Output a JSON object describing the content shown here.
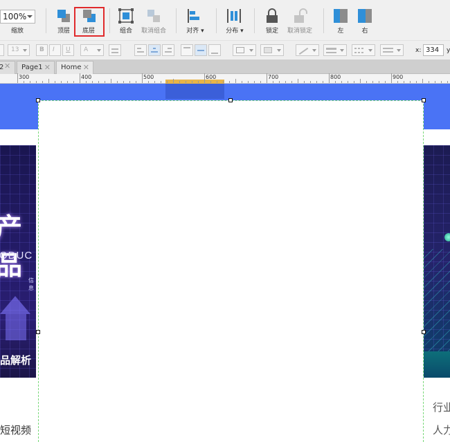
{
  "toolbar": {
    "zoom_value": "100%",
    "zoom_label": "缩放",
    "tools": [
      {
        "label": "顶层",
        "icon": "bring-to-front-icon",
        "enabled": true
      },
      {
        "label": "底层",
        "icon": "send-to-back-icon",
        "enabled": true,
        "highlighted": true
      },
      {
        "label": "组合",
        "icon": "group-icon",
        "enabled": true
      },
      {
        "label": "取消组合",
        "icon": "ungroup-icon",
        "enabled": false
      },
      {
        "label": "对齐",
        "icon": "align-icon",
        "enabled": true,
        "dropdown": true
      },
      {
        "label": "分布",
        "icon": "distribute-icon",
        "enabled": true,
        "dropdown": true
      },
      {
        "label": "锁定",
        "icon": "lock-icon",
        "enabled": true
      },
      {
        "label": "取消锁定",
        "icon": "unlock-icon",
        "enabled": false
      },
      {
        "label": "左",
        "icon": "align-left-icon",
        "enabled": true
      },
      {
        "label": "右",
        "icon": "align-right-icon",
        "enabled": true
      }
    ],
    "highlight_color": "#e0292b",
    "icon_color": "#2f8fd8"
  },
  "format_bar": {
    "font_size": "13",
    "bold": "B",
    "italic": "I",
    "underline": "U",
    "font_color": "A",
    "x_label": "x:",
    "x_value": "334",
    "y_label": "y"
  },
  "tabs": [
    {
      "label": "2"
    },
    {
      "label": "Page1"
    },
    {
      "label": "Home"
    }
  ],
  "ruler": {
    "labels": [
      "300",
      "400",
      "500",
      "600",
      "700",
      "800",
      "900"
    ]
  },
  "canvas": {
    "brand_color": "#4a73f5",
    "banner_left": {
      "big_text": "产品",
      "product_text": "ODUC",
      "tiny_text": "信息",
      "subtitle": "品解析"
    },
    "text_left": "短视频",
    "text_right_1": "行业",
    "text_right_2": "人力"
  }
}
